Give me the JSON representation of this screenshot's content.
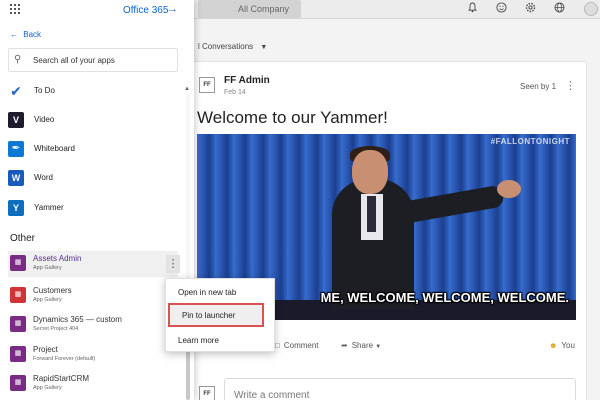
{
  "topbar": {
    "company": "All Company",
    "icons": [
      "bell-icon",
      "smiley-icon",
      "gear-icon",
      "globe-icon",
      "avatar"
    ]
  },
  "launcher": {
    "brand": "Office 365",
    "back": "Back",
    "search_placeholder": "Search all of your apps",
    "apps": [
      {
        "label": "To Do",
        "icon": "todo-icon",
        "color": "#2564cf"
      },
      {
        "label": "Video",
        "icon": "video-icon",
        "color": "#1c1c2e"
      },
      {
        "label": "Whiteboard",
        "icon": "whiteboard-icon",
        "color": "#0f78d4"
      },
      {
        "label": "Word",
        "icon": "word-icon",
        "color": "#185abd"
      },
      {
        "label": "Yammer",
        "icon": "yammer-icon",
        "color": "#106ebe"
      }
    ],
    "other_heading": "Other",
    "other_apps": [
      {
        "name": "Assets Admin",
        "sub": "App Gallery",
        "color": "#7a2b84"
      },
      {
        "name": "Customers",
        "sub": "App Gallery",
        "color": "#d13438"
      },
      {
        "name": "Dynamics 365 — custom",
        "sub": "Secret Project 404",
        "color": "#7a2b84"
      },
      {
        "name": "Project",
        "sub": "Forward Forever (default)",
        "color": "#7a2b84"
      },
      {
        "name": "RapidStartCRM",
        "sub": "App Gallery",
        "color": "#7a2b84"
      }
    ]
  },
  "context_menu": {
    "items": [
      "Open in new tab",
      "Pin to launcher",
      "Learn more"
    ],
    "highlight_color": "#d9534f"
  },
  "feed": {
    "subtitle": "l Conversations",
    "author": "FF Admin",
    "date": "Feb 14",
    "seen_by": "Seen by 1",
    "post_title": "Welcome to our Yammer!",
    "gif_watermark": "#FALLONTONIGHT",
    "gif_caption": "ME, WELCOME, WELCOME, WELCOME.",
    "avatar_initials": "FF",
    "actions": {
      "comment": "Comment",
      "share": "Share",
      "reaction": "You"
    },
    "comment_placeholder": "Write a comment"
  }
}
